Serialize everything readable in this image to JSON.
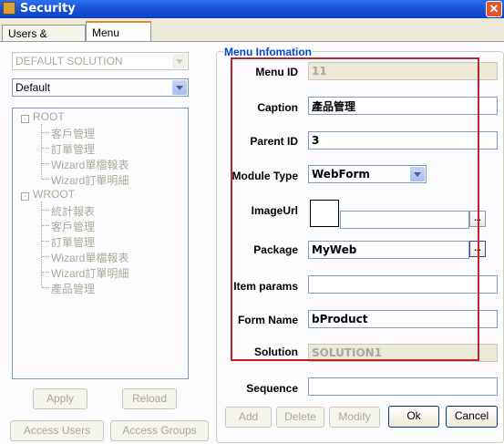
{
  "window": {
    "title": "Security",
    "app_icon": "security-app-icon",
    "close_glyph": "✕"
  },
  "tabs": [
    {
      "label": "Users & Groups"
    },
    {
      "label": "Menu Utility"
    }
  ],
  "left": {
    "solution_combo": {
      "value": "DEFAULT SOLUTION",
      "enabled": false
    },
    "default_combo": {
      "value": "Default"
    },
    "tree": {
      "root": {
        "label": "ROOT",
        "expander": "-",
        "children": [
          "客戶管理",
          "訂單管理",
          "Wizard單檔報表",
          "Wizard訂單明細"
        ]
      },
      "wroot": {
        "label": "WROOT",
        "expander": "-",
        "children": [
          "統計報表",
          "客戶管理",
          "訂單管理",
          "Wizard單檔報表",
          "Wizard訂單明細",
          "產品管理"
        ]
      }
    },
    "apply_label": "Apply",
    "reload_label": "Reload",
    "access_users_label": "Access Users",
    "access_groups_label": "Access Groups"
  },
  "menu_info": {
    "group_title": "Menu Infomation",
    "menu_id": {
      "label": "Menu ID",
      "value": "11"
    },
    "caption": {
      "label": "Caption",
      "value": "產品管理"
    },
    "parent_id": {
      "label": "Parent ID",
      "value": "3"
    },
    "module_type": {
      "label": "Module Type",
      "value": "WebForm"
    },
    "image_url": {
      "label": "ImageUrl",
      "value": ""
    },
    "package": {
      "label": "Package",
      "value": "MyWeb"
    },
    "item_params": {
      "label": "Item params",
      "value": ""
    },
    "form_name": {
      "label": "Form Name",
      "value": "bProduct"
    },
    "solution": {
      "label": "Solution",
      "value": "SOLUTION1"
    },
    "sequence": {
      "label": "Sequence",
      "value": ""
    },
    "ellipsis_glyph": "..."
  },
  "buttons": {
    "add": "Add",
    "delete": "Delete",
    "modify": "Modify",
    "ok": "Ok",
    "cancel": "Cancel"
  },
  "colors": {
    "title_bar": "#0a3fc4",
    "group_title": "#0046d5",
    "highlight_box": "#b9262c",
    "disabled_text": "#aca899"
  }
}
